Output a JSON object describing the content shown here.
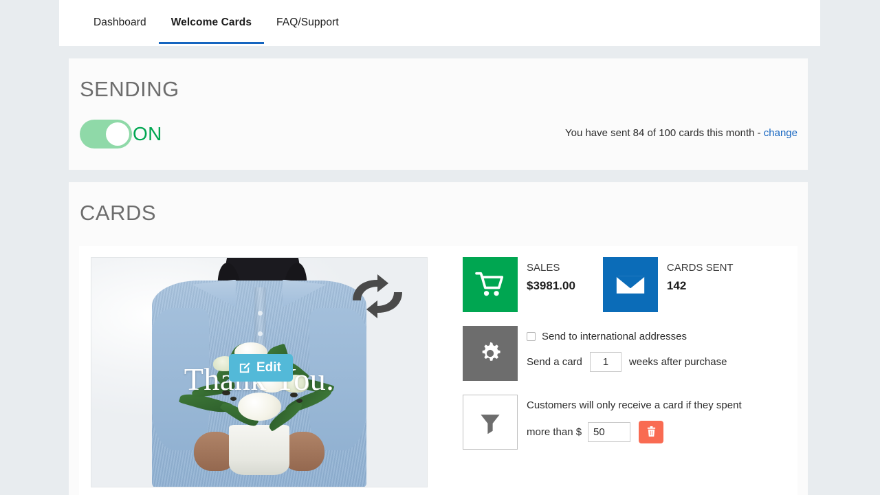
{
  "nav": {
    "tabs": [
      {
        "label": "Dashboard",
        "active": false
      },
      {
        "label": "Welcome Cards",
        "active": true
      },
      {
        "label": "FAQ/Support",
        "active": false
      }
    ]
  },
  "sending": {
    "title": "SENDING",
    "toggle_state": "ON",
    "toggle_on_color": "#8fd9a8",
    "toggle_label_color": "#00a651",
    "quota_text": "You have sent 84 of 100 cards this month - ",
    "quota_sent": "84",
    "quota_limit": "100",
    "change_link": "change",
    "link_color": "#1565c0"
  },
  "cards": {
    "title": "CARDS",
    "preview": {
      "overlay_text": "Thank You.",
      "edit_button": "Edit",
      "edit_button_color": "#53b9d8",
      "refresh_icon": "refresh-swap-icon"
    },
    "stats": [
      {
        "icon": "shopping-cart-icon",
        "icon_bg": "#00a651",
        "label": "SALES",
        "value": "$3981.00"
      },
      {
        "icon": "envelope-icon",
        "icon_bg": "#0b6cb8",
        "label": "CARDS SENT",
        "value": "142"
      }
    ],
    "settings": {
      "icon": "gear-icon",
      "icon_bg": "#6d6d6d",
      "international_label": "Send to international addresses",
      "international_checked": false,
      "delay_prefix": "Send a card",
      "delay_value": "1",
      "delay_suffix": "weeks after purchase"
    },
    "filter": {
      "icon": "funnel-icon",
      "description": "Customers will only receive a card if they spent",
      "amount_prefix": "more than $",
      "amount_value": "50",
      "delete_icon": "trash-icon",
      "delete_color": "#f96b52"
    }
  }
}
